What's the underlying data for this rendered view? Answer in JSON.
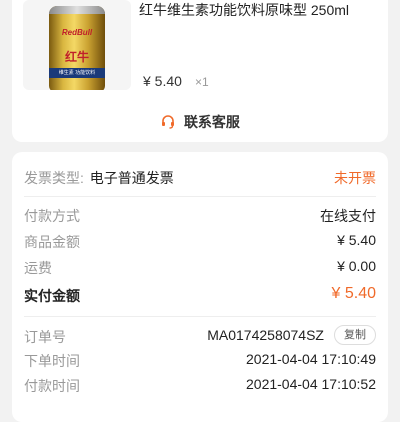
{
  "product": {
    "title": "红牛维生素功能饮料原味型 250ml",
    "price": "¥ 5.40",
    "quantity": "×1",
    "image_text": {
      "logo": "RedBull",
      "name": "红牛",
      "band": "维生素 功能饮料"
    }
  },
  "contact": {
    "label": "联系客服",
    "icon": "customer-service-icon"
  },
  "invoice": {
    "label": "发票类型:",
    "value": "电子普通发票",
    "status": "未开票"
  },
  "payment": {
    "method_label": "付款方式",
    "method_value": "在线支付",
    "goods_label": "商品金额",
    "goods_value": "¥ 5.40",
    "shipping_label": "运费",
    "shipping_value": "¥ 0.00",
    "total_label": "实付金额",
    "total_value": "¥ 5.40"
  },
  "order": {
    "number_label": "订单号",
    "number_value": "MA0174258074SZ",
    "copy_label": "复制",
    "order_time_label": "下单时间",
    "order_time_value": "2021-04-04 17:10:49",
    "pay_time_label": "付款时间",
    "pay_time_value": "2021-04-04 17:10:52"
  },
  "colors": {
    "accent": "#f06a2a",
    "muted": "#999999",
    "background": "#f2f2f2"
  }
}
